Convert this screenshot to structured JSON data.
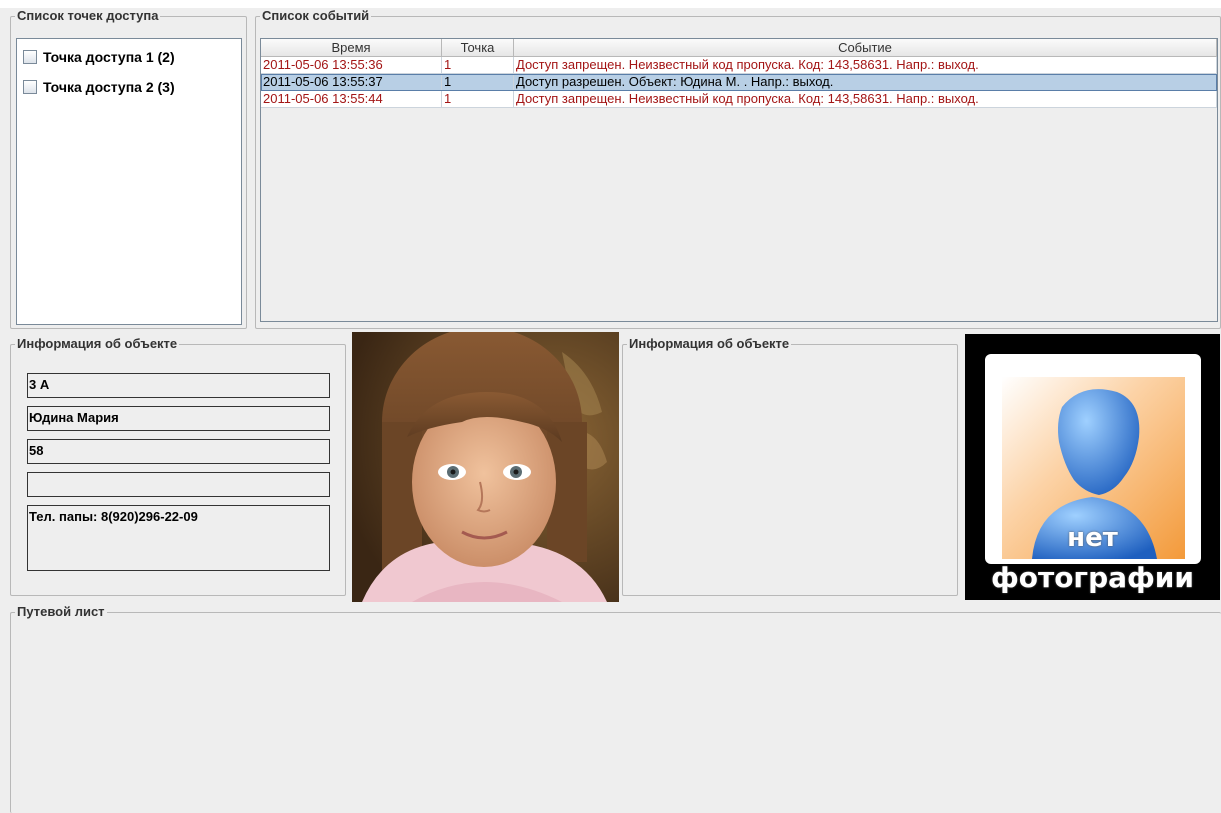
{
  "access_points": {
    "title": "Список точек доступа",
    "items": [
      {
        "label": "Точка доступа 1 (2)"
      },
      {
        "label": "Точка доступа 2 (3)"
      }
    ]
  },
  "events": {
    "title": "Список событий",
    "columns": [
      "Время",
      "Точка",
      "Событие"
    ],
    "rows": [
      {
        "time": "2011-05-06 13:55:36",
        "point": "1",
        "event": "Доступ запрещен. Неизвестный код пропуска. Код: 143,58631. Напр.: выход.",
        "status": "denied"
      },
      {
        "time": "2011-05-06 13:55:37",
        "point": "1",
        "event": "Доступ разрешен. Объект: Юдина М. . Напр.: выход.",
        "status": "allowed"
      },
      {
        "time": "2011-05-06 13:55:44",
        "point": "1",
        "event": "Доступ запрещен. Неизвестный код пропуска. Код: 143,58631. Напр.: выход.",
        "status": "denied"
      }
    ]
  },
  "object_info_1": {
    "title": "Информация об объекте",
    "fields": [
      "3 А",
      "Юдина Мария",
      "58",
      "",
      "Тел. папы: 8(920)296-22-09"
    ]
  },
  "object_info_2": {
    "title": "Информация об объекте"
  },
  "no_photo": {
    "line1": "нет",
    "line2": "фотографии"
  },
  "route_sheet": {
    "title": "Путевой лист"
  },
  "colors": {
    "denied_text": "#a31515",
    "selected_row": "#b8cfe5",
    "panel_bg": "#eeeeee"
  }
}
